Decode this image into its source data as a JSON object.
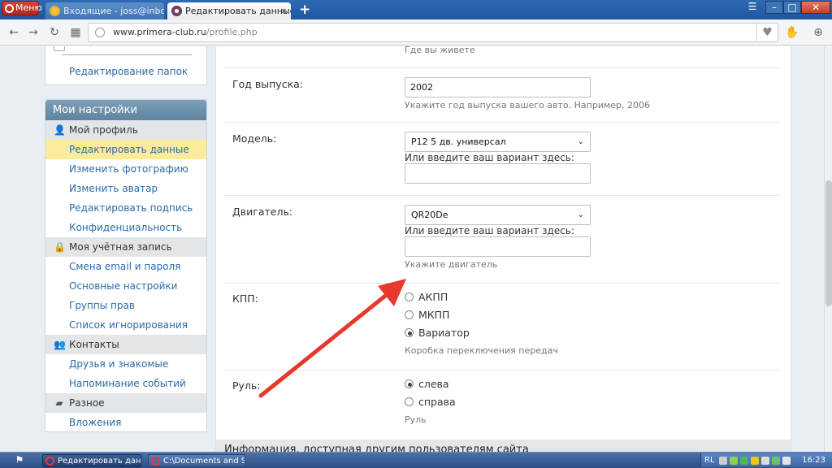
{
  "browser": {
    "menu_label": "Меню",
    "tabs": [
      {
        "label": "Входящие - joss@inbox.ru -",
        "close": "×"
      },
      {
        "label": "Редактировать данные - Р",
        "close": "×"
      }
    ],
    "new_tab": "+",
    "url_domain": "www.primera-club.ru",
    "url_path": "/profile.php"
  },
  "sidebar": {
    "top_link": "Редактирование папок",
    "header": "Мои настройки",
    "groups": [
      {
        "label": "Мой профиль",
        "icon": "user-icon",
        "items": [
          "Редактировать данные",
          "Изменить фотографию",
          "Изменить аватар",
          "Редактировать подпись",
          "Конфиденциальность"
        ]
      },
      {
        "label": "Моя учётная запись",
        "icon": "lock-icon",
        "items": [
          "Смена email и пароля",
          "Основные настройки",
          "Группы прав",
          "Список игнорирования"
        ]
      },
      {
        "label": "Контакты",
        "icon": "contacts-icon",
        "items": [
          "Друзья и знакомые",
          "Напоминание событий"
        ]
      },
      {
        "label": "Разное",
        "icon": "misc-icon",
        "items": [
          "Вложения"
        ]
      }
    ],
    "active_item": "Редактировать данные"
  },
  "form": {
    "residence_hint": "Где вы живете",
    "year": {
      "label": "Год выпуска:",
      "value": "2002",
      "hint": "Укажите год выпуска вашего авто. Например, 2006"
    },
    "model": {
      "label": "Модель:",
      "selected": "P12 5 дв. универсал",
      "alt_label": "Или введите ваш вариант здесь:",
      "alt_value": ""
    },
    "engine": {
      "label": "Двигатель:",
      "selected": "QR20De",
      "alt_label": "Или введите ваш вариант здесь:",
      "alt_value": "",
      "hint": "Укажите двигатель"
    },
    "gearbox": {
      "label": "КПП:",
      "options": [
        "АКПП",
        "МКПП",
        "Вариатор"
      ],
      "selected": "Вариатор",
      "hint": "Коробка переключения передач"
    },
    "steering": {
      "label": "Руль:",
      "options": [
        "слева",
        "справа"
      ],
      "selected": "слева",
      "hint": "Руль"
    },
    "section_footer": "Информация, доступная другим пользователям сайта"
  },
  "annotation": {
    "arrow_color": "#e8382b"
  },
  "taskbar": {
    "tasks": [
      "Редактировать данн...",
      "C:\\Documents and Set..."
    ],
    "lang": "RL",
    "clock": "16:23"
  }
}
